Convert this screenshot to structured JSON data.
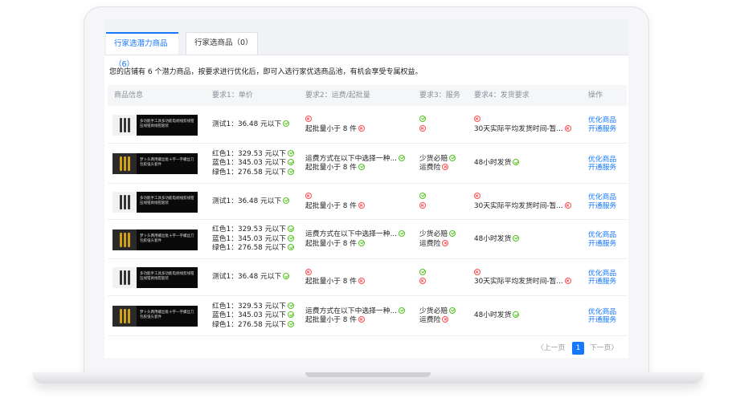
{
  "tabs": [
    {
      "label": "行家选潜力商品（6）"
    },
    {
      "label": "行家选商品（0）"
    }
  ],
  "notice": "您的店铺有 6 个潜力商品，按要求进行优化后，即可入选行家优选商品池，有机会享受专属权益。",
  "columns": [
    "商品信息",
    "要求1：单价",
    "要求2：运费/起批量",
    "要求3：服务",
    "要求4：发货要求",
    "操作"
  ],
  "products": {
    "a": {
      "caption": "多功能手工具多功能电剥线剪线钳压线钳剥线钳套装"
    },
    "b": {
      "caption": "梦卜头两用螺丝批十字一字螺丝刀包胶强头套件"
    }
  },
  "rows": [
    {
      "price": [
        "测试1：36.48 元以下"
      ],
      "req2": [
        {
          "text": "",
          "bad": true
        },
        {
          "text": "起批量小于 8 件",
          "bad": true
        }
      ],
      "req3": [
        {
          "text": "",
          "bad": false
        },
        {
          "text": "",
          "bad": true
        }
      ],
      "req4": [
        {
          "text": "",
          "bad": true
        },
        {
          "text": "30天实际平均发货时间-暂...",
          "bad": true
        }
      ],
      "op": [
        "优化商品",
        "开通服务"
      ]
    },
    {
      "price": [
        "红色1：329.53 元以下",
        "蓝色1：345.03 元以下",
        "绿色1：276.58 元以下"
      ],
      "req2": [
        {
          "text": "运费方式在以下中选择一种...",
          "bad": false
        },
        {
          "text": "起批量小于 8 件",
          "bad": false
        }
      ],
      "req3": [
        {
          "text": "少货必赔",
          "bad": false
        },
        {
          "text": "运费险",
          "bad": true
        }
      ],
      "req4": [
        {
          "text": "48小时发货",
          "bad": false
        }
      ],
      "op": [
        "优化商品",
        "开通服务"
      ]
    },
    {
      "price": [
        "测试1：36.48 元以下"
      ],
      "req2": [
        {
          "text": "",
          "bad": true
        },
        {
          "text": "起批量小于 8 件",
          "bad": true
        }
      ],
      "req3": [
        {
          "text": "",
          "bad": false
        },
        {
          "text": "",
          "bad": true
        }
      ],
      "req4": [
        {
          "text": "",
          "bad": true
        },
        {
          "text": "30天实际平均发货时间-暂...",
          "bad": true
        }
      ],
      "op": [
        "优化商品",
        "开通服务"
      ]
    },
    {
      "price": [
        "红色1：329.53 元以下",
        "蓝色1：345.03 元以下",
        "绿色1：276.58 元以下"
      ],
      "req2": [
        {
          "text": "运费方式在以下中选择一种...",
          "bad": false
        },
        {
          "text": "起批量小于 8 件",
          "bad": false
        }
      ],
      "req3": [
        {
          "text": "少货必赔",
          "bad": false
        },
        {
          "text": "运费险",
          "bad": true
        }
      ],
      "req4": [
        {
          "text": "48小时发货",
          "bad": false
        }
      ],
      "op": [
        "优化商品",
        "开通服务"
      ]
    },
    {
      "price": [
        "测试1：36.48 元以下"
      ],
      "req2": [
        {
          "text": "",
          "bad": true
        },
        {
          "text": "起批量小于 8 件",
          "bad": true
        }
      ],
      "req3": [
        {
          "text": "",
          "bad": false
        },
        {
          "text": "",
          "bad": true
        }
      ],
      "req4": [
        {
          "text": "",
          "bad": true
        },
        {
          "text": "30天实际平均发货时间-暂...",
          "bad": true
        }
      ],
      "op": [
        "优化商品",
        "开通服务"
      ]
    },
    {
      "price": [
        "红色1：329.53 元以下",
        "蓝色1：345.03 元以下",
        "绿色1：276.58 元以下"
      ],
      "req2": [
        {
          "text": "运费方式在以下中选择一种...",
          "bad": false
        },
        {
          "text": "起批量小于 8 件",
          "bad": true
        }
      ],
      "req3": [
        {
          "text": "少货必赔",
          "bad": false
        },
        {
          "text": "运费险",
          "bad": true
        }
      ],
      "req4": [
        {
          "text": "48小时发货",
          "bad": false
        }
      ],
      "op": [
        "优化商品",
        "开通服务"
      ]
    }
  ],
  "pagination": {
    "prev": "〈上一页",
    "current": "1",
    "next": "下一页〉"
  },
  "icons": {
    "ok": "check-circle-icon",
    "bad": "x-circle-icon"
  },
  "colors": {
    "accent": "#1677ff",
    "ok": "#52c41a",
    "bad": "#ff4d4f"
  }
}
